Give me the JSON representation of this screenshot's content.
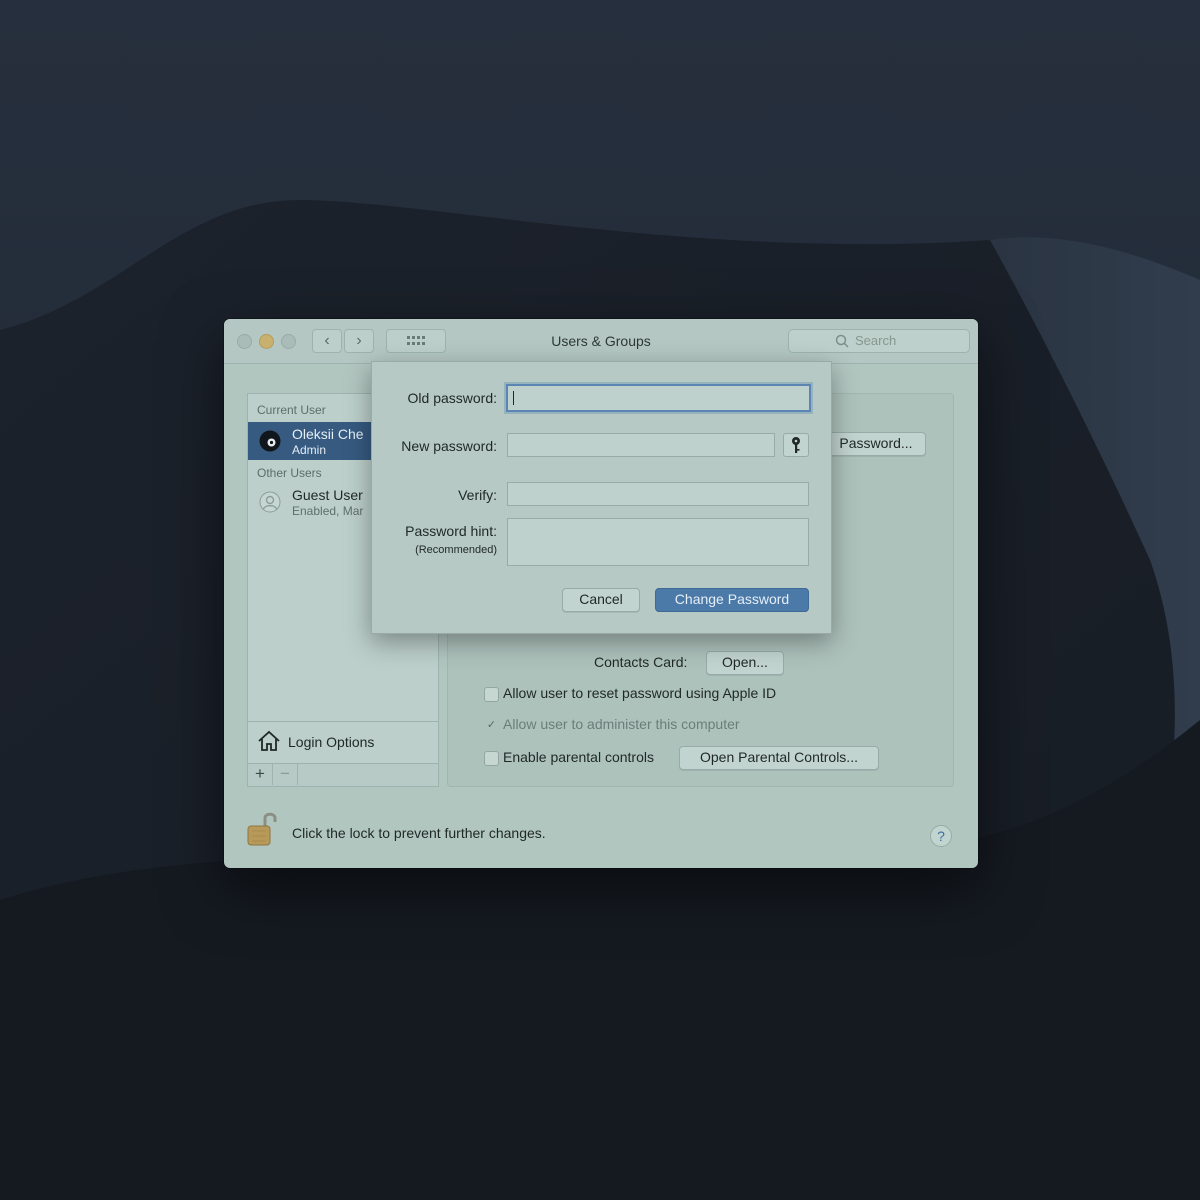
{
  "window": {
    "title": "Users & Groups",
    "search_placeholder": "Search"
  },
  "sidebar": {
    "current_user_header": "Current User",
    "current_user": {
      "name": "Oleksii Che",
      "role": "Admin"
    },
    "other_users_header": "Other Users",
    "guest_user": {
      "name": "Guest User",
      "status": "Enabled, Mar"
    },
    "login_options_label": "Login Options",
    "add_label": "+",
    "remove_label": "−"
  },
  "main": {
    "password_button_label": "Password...",
    "contacts_card_label": "Contacts Card:",
    "open_button_label": "Open...",
    "reset_password_checkbox_label": "Allow user to reset password using Apple ID",
    "administer_checkbox_label": "Allow user to administer this computer",
    "parental_controls_checkbox_label": "Enable parental controls",
    "open_parental_controls_label": "Open Parental Controls..."
  },
  "footer": {
    "lock_text": "Click the lock to prevent further changes.",
    "help_label": "?"
  },
  "sheet": {
    "old_password_label": "Old password:",
    "new_password_label": "New password:",
    "verify_label": "Verify:",
    "hint_label": "Password hint:",
    "hint_sublabel": "(Recommended)",
    "cancel_label": "Cancel",
    "change_password_label": "Change Password"
  },
  "colors": {
    "window_bg": "#b2c6c0",
    "selection": "#365a80",
    "primary_button": "#4c7aa8",
    "desktop": "#222a36"
  }
}
